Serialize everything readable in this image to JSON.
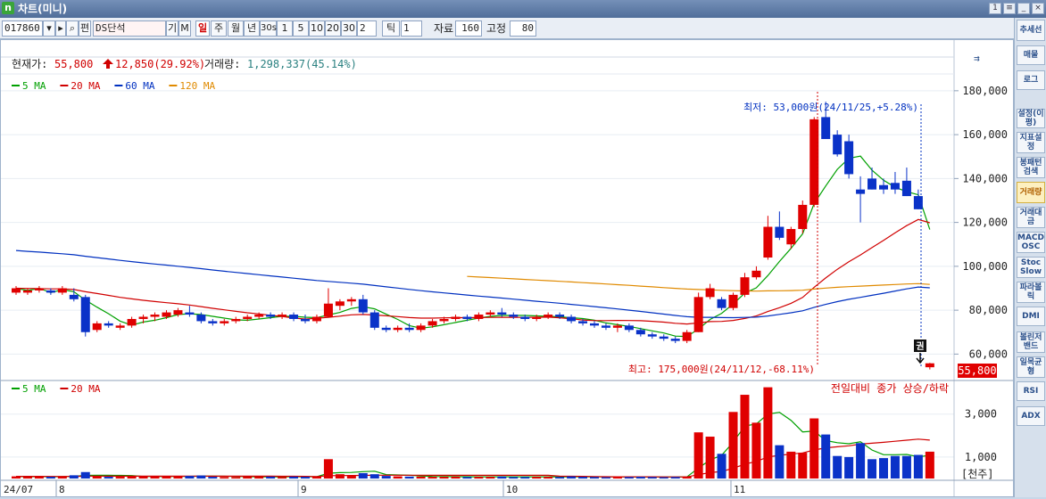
{
  "window": {
    "title": "차트(미니)",
    "logo": "n"
  },
  "toolbar": {
    "code": "017860",
    "name": "DS단석",
    "periods": [
      "일",
      "주",
      "월",
      "년",
      "30s",
      "1",
      "5",
      "10",
      "20",
      "30"
    ],
    "active_period": "일",
    "interval_value": "2",
    "tick_label": "틱",
    "tick_value": "1",
    "data_label": "자료",
    "data_value": "160",
    "fixed_label": "고정",
    "fixed_value": "80",
    "btn_giup": "기",
    "btn_m": "M",
    "btn_pyeon": "편"
  },
  "info": {
    "price_label": "현재가:",
    "price": "55,800",
    "change": "12,850(29.92%)",
    "volume_label": "거래량:",
    "volume": "1,298,337(45.14%)"
  },
  "legend_price": [
    {
      "label": "5 MA",
      "color": "#00a000"
    },
    {
      "label": "20 MA",
      "color": "#d00000"
    },
    {
      "label": "60 MA",
      "color": "#0030c0"
    },
    {
      "label": "120 MA",
      "color": "#e08a00"
    }
  ],
  "legend_volume": [
    {
      "label": "5 MA",
      "color": "#00a000"
    },
    {
      "label": "20 MA",
      "color": "#d00000"
    }
  ],
  "annotations": {
    "min_text": "최저: 53,000원(24/11/25,+5.28%)",
    "max_text": "최고: 175,000원(24/11/12,-68.11%)",
    "volume_note": "전일대비 종가 상승/하락",
    "badge": "권",
    "current_price_tag": "55,800",
    "volume_unit": "[천주]"
  },
  "chart_data": {
    "type": "candlestick",
    "price_axis_ticks": [
      "180,000",
      "160,000",
      "140,000",
      "120,000",
      "100,000",
      "80,000",
      "60,000"
    ],
    "price_ylim": [
      50000,
      184000
    ],
    "volume_axis_ticks": [
      "3,000",
      "1,000"
    ],
    "volume_ylim": [
      0,
      4400
    ],
    "x_labels": [
      "24/07",
      "8",
      "9",
      "10",
      "11"
    ],
    "candles": [
      [
        88,
        91,
        87,
        90
      ],
      [
        88,
        90,
        87,
        89
      ],
      [
        89,
        91,
        88,
        90
      ],
      [
        89,
        90,
        87,
        88
      ],
      [
        88,
        91,
        87,
        90
      ],
      [
        87,
        90,
        84,
        85
      ],
      [
        86,
        87,
        68,
        70
      ],
      [
        71,
        75,
        70,
        74
      ],
      [
        74,
        75,
        72,
        73
      ],
      [
        72,
        74,
        71,
        73
      ],
      [
        73,
        77,
        72,
        76
      ],
      [
        76,
        78,
        74,
        77
      ],
      [
        77,
        79,
        75,
        78
      ],
      [
        77,
        80,
        76,
        79
      ],
      [
        78,
        81,
        77,
        80
      ],
      [
        79,
        82,
        77,
        78
      ],
      [
        78,
        79,
        74,
        75
      ],
      [
        75,
        76,
        73,
        74
      ],
      [
        74,
        76,
        73,
        75
      ],
      [
        75,
        77,
        74,
        76
      ],
      [
        76,
        78,
        75,
        77
      ],
      [
        77,
        79,
        76,
        78
      ],
      [
        78,
        79,
        76,
        77
      ],
      [
        77,
        79,
        76,
        78
      ],
      [
        78,
        79,
        75,
        76
      ],
      [
        76,
        78,
        74,
        75
      ],
      [
        75,
        78,
        74,
        77
      ],
      [
        77,
        90,
        77,
        83
      ],
      [
        82,
        85,
        80,
        84
      ],
      [
        84,
        86,
        82,
        85
      ],
      [
        85,
        87,
        78,
        79
      ],
      [
        79,
        80,
        71,
        72
      ],
      [
        72,
        73,
        70,
        71
      ],
      [
        71,
        73,
        70,
        72
      ],
      [
        72,
        74,
        70,
        71
      ],
      [
        71,
        74,
        70,
        73
      ],
      [
        73,
        76,
        72,
        75
      ],
      [
        75,
        77,
        74,
        76
      ],
      [
        76,
        78,
        75,
        77
      ],
      [
        77,
        78,
        75,
        76
      ],
      [
        76,
        79,
        75,
        78
      ],
      [
        78,
        80,
        77,
        79
      ],
      [
        79,
        81,
        77,
        78
      ],
      [
        78,
        79,
        76,
        77
      ],
      [
        77,
        78,
        75,
        76
      ],
      [
        76,
        78,
        75,
        77
      ],
      [
        77,
        79,
        76,
        78
      ],
      [
        78,
        79,
        76,
        77
      ],
      [
        77,
        78,
        74,
        75
      ],
      [
        75,
        76,
        73,
        74
      ],
      [
        74,
        75,
        72,
        73
      ],
      [
        73,
        74,
        71,
        72
      ],
      [
        72,
        74,
        70,
        73
      ],
      [
        73,
        74,
        70,
        71
      ],
      [
        71,
        72,
        68,
        69
      ],
      [
        69,
        70,
        67,
        68
      ],
      [
        68,
        69,
        66,
        67
      ],
      [
        67,
        68,
        65,
        66
      ],
      [
        66,
        71,
        65,
        70
      ],
      [
        70,
        88,
        70,
        86
      ],
      [
        86,
        92,
        85,
        90
      ],
      [
        85,
        86,
        80,
        81
      ],
      [
        81,
        88,
        80,
        87
      ],
      [
        87,
        97,
        86,
        95
      ],
      [
        95,
        100,
        94,
        98
      ],
      [
        104,
        123,
        103,
        118
      ],
      [
        118,
        125,
        112,
        113
      ],
      [
        110,
        118,
        108,
        117
      ],
      [
        117,
        130,
        115,
        128
      ],
      [
        128,
        168,
        127,
        167
      ],
      [
        168,
        175,
        161,
        158
      ],
      [
        160,
        162,
        150,
        151
      ],
      [
        157,
        160,
        140,
        142
      ],
      [
        135,
        141,
        120,
        133
      ],
      [
        140,
        145,
        135,
        135
      ],
      [
        137,
        140,
        133,
        135
      ],
      [
        138,
        143,
        133,
        135
      ],
      [
        139,
        145,
        132,
        132
      ],
      [
        132,
        135,
        126,
        126
      ],
      [
        54,
        56,
        53,
        55.8
      ]
    ],
    "volumes": [
      100,
      80,
      90,
      80,
      100,
      150,
      300,
      120,
      80,
      80,
      110,
      90,
      90,
      90,
      100,
      120,
      140,
      80,
      70,
      70,
      80,
      80,
      90,
      70,
      90,
      80,
      90,
      900,
      200,
      150,
      250,
      200,
      120,
      100,
      90,
      90,
      80,
      80,
      90,
      70,
      80,
      80,
      90,
      70,
      70,
      80,
      80,
      70,
      100,
      80,
      70,
      60,
      80,
      70,
      80,
      70,
      60,
      70,
      90,
      2150,
      1950,
      1150,
      3100,
      3900,
      2600,
      4250,
      1550,
      1250,
      1200,
      2800,
      2050,
      1050,
      1000,
      1650,
      900,
      950,
      1050,
      1050,
      1100,
      1250
    ]
  },
  "sidebar": [
    {
      "label": "추세선",
      "active": false
    },
    {
      "label": "매물",
      "active": false
    },
    {
      "label": "로그",
      "active": false
    },
    {
      "label": "설정(이평)",
      "active": false
    },
    {
      "label": "지표설정",
      "active": false
    },
    {
      "label": "봉패턴검색",
      "active": false
    },
    {
      "label": "거래량",
      "active": true
    },
    {
      "label": "거래대금",
      "active": false
    },
    {
      "label": "MACD OSC",
      "active": false
    },
    {
      "label": "Stoc Slow",
      "active": false
    },
    {
      "label": "파라볼릭",
      "active": false
    },
    {
      "label": "DMI",
      "active": false
    },
    {
      "label": "볼린저밴드",
      "active": false
    },
    {
      "label": "일목균형",
      "active": false
    },
    {
      "label": "RSI",
      "active": false
    },
    {
      "label": "ADX",
      "active": false
    }
  ]
}
